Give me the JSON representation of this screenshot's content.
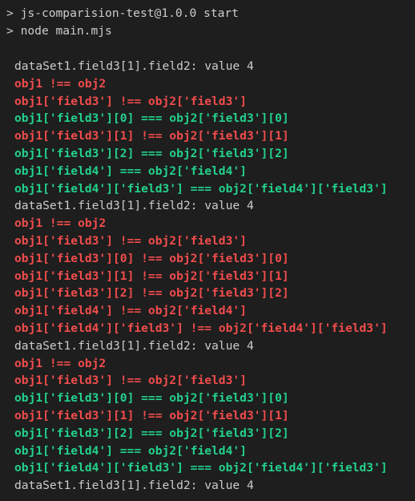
{
  "commands": [
    {
      "prompt": ">",
      "text": "js-comparision-test@1.0.0 start"
    },
    {
      "prompt": ">",
      "text": "node main.mjs"
    }
  ],
  "colors": {
    "background": "#1e1e1e",
    "default_text": "#cccccc",
    "fail": "#f14c4c",
    "pass": "#23d18b"
  },
  "output": [
    {
      "status": "info",
      "text": "dataSet1.field3[1].field2: value 4"
    },
    {
      "status": "fail",
      "text": "obj1 !== obj2"
    },
    {
      "status": "fail",
      "text": "obj1['field3'] !== obj2['field3']"
    },
    {
      "status": "pass",
      "text": "obj1['field3'][0] === obj2['field3'][0]"
    },
    {
      "status": "fail",
      "text": "obj1['field3'][1] !== obj2['field3'][1]"
    },
    {
      "status": "pass",
      "text": "obj1['field3'][2] === obj2['field3'][2]"
    },
    {
      "status": "pass",
      "text": "obj1['field4'] === obj2['field4']"
    },
    {
      "status": "pass",
      "text": "obj1['field4']['field3'] === obj2['field4']['field3']"
    },
    {
      "status": "info",
      "text": "dataSet1.field3[1].field2: value 4"
    },
    {
      "status": "fail",
      "text": "obj1 !== obj2"
    },
    {
      "status": "fail",
      "text": "obj1['field3'] !== obj2['field3']"
    },
    {
      "status": "fail",
      "text": "obj1['field3'][0] !== obj2['field3'][0]"
    },
    {
      "status": "fail",
      "text": "obj1['field3'][1] !== obj2['field3'][1]"
    },
    {
      "status": "fail",
      "text": "obj1['field3'][2] !== obj2['field3'][2]"
    },
    {
      "status": "fail",
      "text": "obj1['field4'] !== obj2['field4']"
    },
    {
      "status": "fail",
      "text": "obj1['field4']['field3'] !== obj2['field4']['field3']"
    },
    {
      "status": "info",
      "text": "dataSet1.field3[1].field2: value 4"
    },
    {
      "status": "fail",
      "text": "obj1 !== obj2"
    },
    {
      "status": "fail",
      "text": "obj1['field3'] !== obj2['field3']"
    },
    {
      "status": "pass",
      "text": "obj1['field3'][0] === obj2['field3'][0]"
    },
    {
      "status": "fail",
      "text": "obj1['field3'][1] !== obj2['field3'][1]"
    },
    {
      "status": "pass",
      "text": "obj1['field3'][2] === obj2['field3'][2]"
    },
    {
      "status": "pass",
      "text": "obj1['field4'] === obj2['field4']"
    },
    {
      "status": "pass",
      "text": "obj1['field4']['field3'] === obj2['field4']['field3']"
    },
    {
      "status": "info",
      "text": "dataSet1.field3[1].field2: value 4"
    }
  ]
}
